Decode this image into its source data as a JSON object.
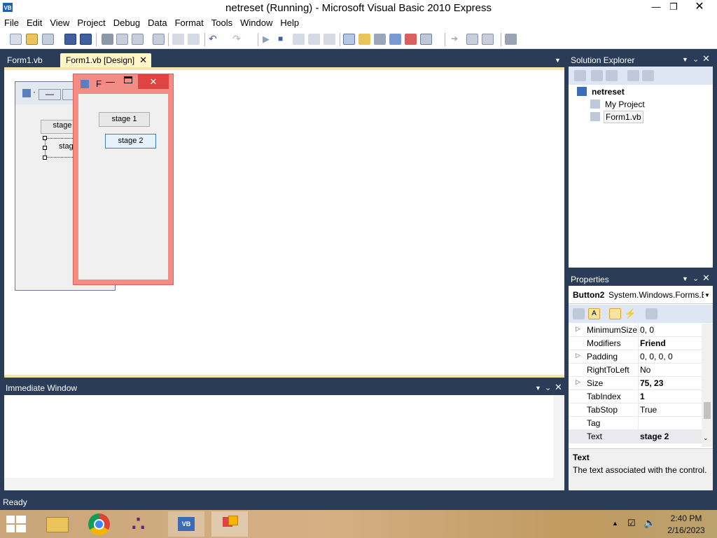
{
  "window": {
    "title": "netreset (Running) - Microsoft Visual Basic 2010 Express",
    "app_icon": "VB"
  },
  "menu": [
    "File",
    "Edit",
    "View",
    "Project",
    "Debug",
    "Data",
    "Format",
    "Tools",
    "Window",
    "Help"
  ],
  "tabs": [
    {
      "label": "Form1.vb",
      "active": false
    },
    {
      "label": "Form1.vb [Design]",
      "active": true
    }
  ],
  "design_form": {
    "title_glyph": "·",
    "buttons": [
      "stage",
      "stag"
    ]
  },
  "running_form": {
    "title": "F",
    "button1": "stage 1",
    "button2": "stage 2"
  },
  "solution_explorer": {
    "header": "Solution Explorer",
    "project": "netreset",
    "items": [
      "My Project",
      "Form1.vb"
    ]
  },
  "properties": {
    "header": "Properties",
    "object_name": "Button2",
    "object_type": "System.Windows.Forms.E",
    "rows": [
      {
        "name": "MinimumSize",
        "value": "0, 0",
        "bold": false,
        "expandable": true
      },
      {
        "name": "Modifiers",
        "value": "Friend",
        "bold": true,
        "expandable": false
      },
      {
        "name": "Padding",
        "value": "0, 0, 0, 0",
        "bold": false,
        "expandable": true
      },
      {
        "name": "RightToLeft",
        "value": "No",
        "bold": false,
        "expandable": false
      },
      {
        "name": "Size",
        "value": "75, 23",
        "bold": true,
        "expandable": true
      },
      {
        "name": "TabIndex",
        "value": "1",
        "bold": true,
        "expandable": false
      },
      {
        "name": "TabStop",
        "value": "True",
        "bold": false,
        "expandable": false
      },
      {
        "name": "Tag",
        "value": "",
        "bold": false,
        "expandable": false
      },
      {
        "name": "Text",
        "value": "stage 2",
        "bold": true,
        "expandable": false
      }
    ],
    "desc_title": "Text",
    "desc_text": "The text associated with the control."
  },
  "immediate": {
    "header": "Immediate Window"
  },
  "status": "Ready",
  "clock": {
    "time": "2:40 PM",
    "date": "2/16/2023"
  },
  "colors": {
    "ide_bg": "#2b3c59",
    "form_border": "#f28c85",
    "tab_active": "#fff6c9",
    "close_red": "#e04343"
  }
}
